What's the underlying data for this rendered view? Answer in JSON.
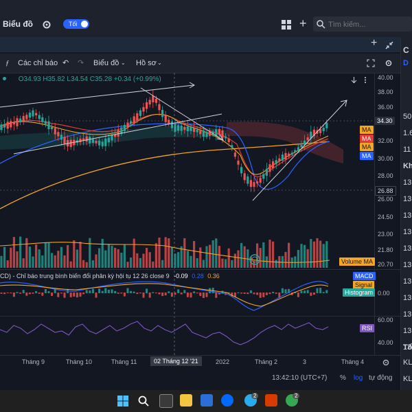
{
  "header": {
    "title": "Biểu đồ",
    "toggle_label": "Tối",
    "search_placeholder": "Tìm kiếm..."
  },
  "toolbar": {
    "indicators_label": "Các chỉ báo",
    "chart_label": "Biểu đồ",
    "profile_label": "Hồ sơ"
  },
  "ohlc": {
    "open": "O34.93",
    "high": "H35.82",
    "low": "L34.54",
    "close": "C35.28",
    "change": "+0.34 (+0.99%)"
  },
  "price_axis": [
    "40.00",
    "38.00",
    "36.00",
    "34.00",
    "32.00",
    "30.00",
    "28.00",
    "26.00",
    "24.50",
    "23.00",
    "21.80",
    "20.70"
  ],
  "price_badges": {
    "current": "34.30",
    "low_mark": "26.88",
    "ma": [
      "MA",
      "MA",
      "MA",
      "MA"
    ]
  },
  "volume": {
    "label": "Volume MA"
  },
  "macd": {
    "title": "CD) - Chỉ báo trung bình biến đổi phân kỳ hội tụ 12 26 close 9",
    "v1": "-0.09",
    "v2": "0.28",
    "v3": "0.36",
    "legend": [
      "MACD",
      "Signal",
      "Histogram"
    ],
    "zero": "0.00"
  },
  "rsi": {
    "label": "RSI",
    "axis": [
      "60.00",
      "40.00"
    ]
  },
  "time_axis": {
    "labels": [
      "Tháng 9",
      "Tháng 10",
      "Tháng 11",
      "2022",
      "Tháng 2",
      "3",
      "Tháng 4"
    ],
    "cursor_label": "02 Tháng 12 '21"
  },
  "footer": {
    "clock": "13:42:10 (UTC+7)",
    "percent": "%",
    "log": "log",
    "auto": "tự động"
  },
  "right_panel": {
    "header": "C",
    "sub": "D",
    "rows": [
      "50",
      "1.6",
      "11",
      "Kh",
      "13",
      "13",
      "13",
      "13",
      "13",
      "13",
      "13",
      "13",
      "13",
      "13",
      "13",
      "Tổ",
      "KL",
      "KL"
    ]
  },
  "taskbar": {
    "badges": [
      "2",
      "2"
    ]
  },
  "colors": {
    "bg": "#131722",
    "up": "#26a69a",
    "down": "#ef5350",
    "ma_orange": "#f5a623",
    "ma_red": "#e53935",
    "ma_blue": "#2962ff"
  }
}
